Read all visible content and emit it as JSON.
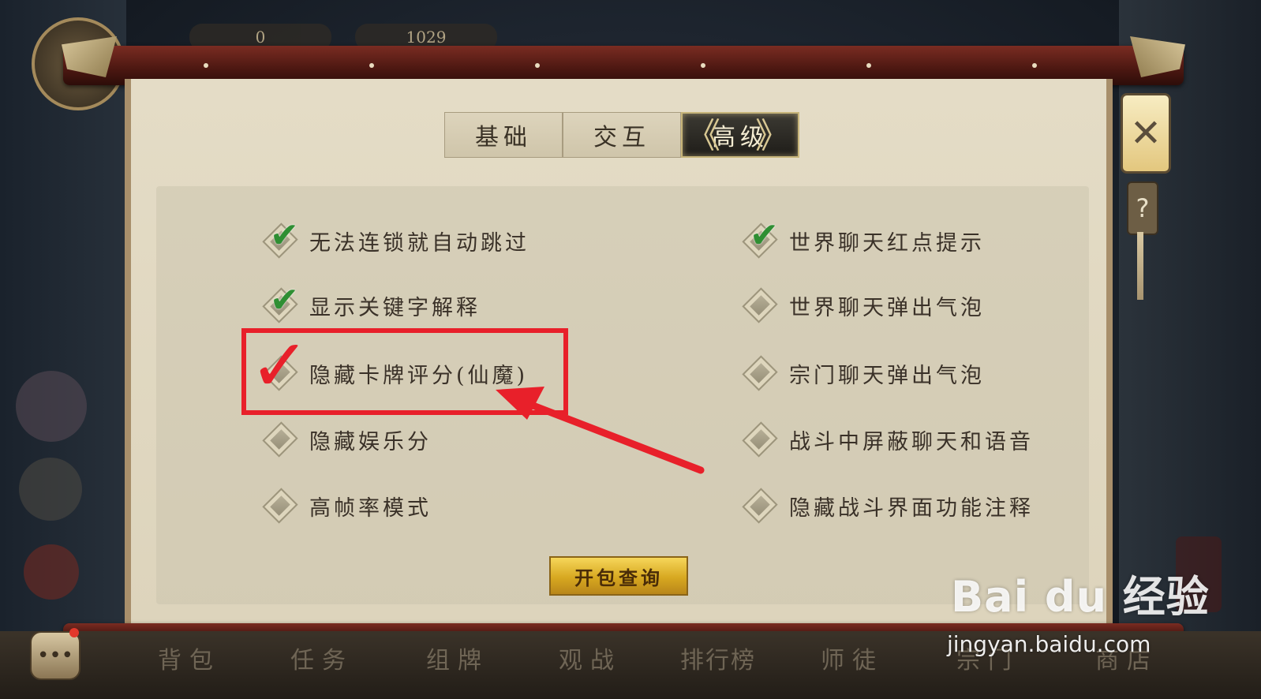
{
  "tabs": [
    {
      "label": "基础",
      "active": false
    },
    {
      "label": "交互",
      "active": false
    },
    {
      "label": "高级",
      "active": true
    }
  ],
  "options_left": [
    {
      "label": "无法连锁就自动跳过",
      "checked": true
    },
    {
      "label": "显示关键字解释",
      "checked": true
    },
    {
      "label": "隐藏卡牌评分(仙魔)",
      "checked": false
    },
    {
      "label": "隐藏娱乐分",
      "checked": false
    },
    {
      "label": "高帧率模式",
      "checked": false
    }
  ],
  "options_right": [
    {
      "label": "世界聊天红点提示",
      "checked": true
    },
    {
      "label": "世界聊天弹出气泡",
      "checked": false
    },
    {
      "label": "宗门聊天弹出气泡",
      "checked": false
    },
    {
      "label": "战斗中屏蔽聊天和语音",
      "checked": false
    },
    {
      "label": "隐藏战斗界面功能注释",
      "checked": false
    }
  ],
  "query_button": "开包查询",
  "close_icon": "close-icon",
  "help_label": "?",
  "hud": {
    "left_value": "0",
    "right_value": "1029"
  },
  "bottom_nav": [
    "背包",
    "任务",
    "组牌",
    "观战",
    "排行榜",
    "师徒",
    "宗门",
    "商店"
  ],
  "chat_glyph": "•••",
  "watermark": {
    "logo": "Bai du 经验",
    "url": "jingyan.baidu.com"
  },
  "colors": {
    "annotation": "#e8202a",
    "check": "#2f8f33",
    "button": "#d7a820"
  }
}
